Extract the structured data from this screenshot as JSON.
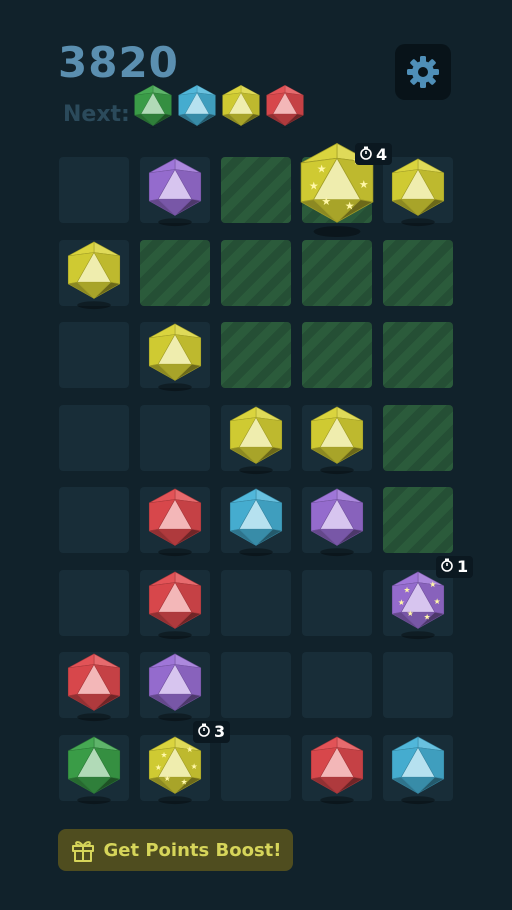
{
  "header": {
    "score": "3820",
    "next_label": "Next:",
    "settings_icon": "gear-icon"
  },
  "next_gems": [
    "green",
    "blue",
    "yellow",
    "red"
  ],
  "colors": {
    "purple": "#9a6fd6",
    "yellow": "#d8d234",
    "red": "#e04a4e",
    "blue": "#48b3d8",
    "green": "#3ca34a",
    "board_bg": "#11222b",
    "cell": "#182d38",
    "cell_green": "#2b5b3b",
    "score": "#5b8fb0",
    "boost_bg": "#4f4d1f",
    "boost_text": "#d6d55a"
  },
  "grid": {
    "rows": 8,
    "cols": 5,
    "cells": [
      [
        "empty",
        "purple",
        "empty",
        "yellow",
        "yellow"
      ],
      [
        "yellow",
        "empty",
        "empty",
        "empty",
        "empty"
      ],
      [
        "empty",
        "yellow",
        "empty",
        "empty",
        "empty"
      ],
      [
        "empty",
        "empty",
        "yellow",
        "yellow",
        "empty"
      ],
      [
        "empty",
        "red",
        "blue",
        "purple",
        "empty"
      ],
      [
        "empty",
        "red",
        "empty",
        "empty",
        "purple"
      ],
      [
        "red",
        "purple",
        "empty",
        "empty",
        "empty"
      ],
      [
        "green",
        "yellow",
        "empty",
        "red",
        "blue"
      ]
    ],
    "highlighted": [
      [
        0,
        2
      ],
      [
        0,
        3
      ],
      [
        1,
        1
      ],
      [
        1,
        2
      ],
      [
        1,
        3
      ],
      [
        1,
        4
      ],
      [
        2,
        2
      ],
      [
        2,
        3
      ],
      [
        2,
        4
      ],
      [
        3,
        4
      ],
      [
        4,
        4
      ]
    ],
    "special": [
      {
        "row": 0,
        "col": 3,
        "timer": "4",
        "big": true
      },
      {
        "row": 5,
        "col": 4,
        "timer": "1",
        "big": false
      },
      {
        "row": 7,
        "col": 1,
        "timer": "3",
        "big": false
      }
    ]
  },
  "boost": {
    "label": "Get Points Boost!",
    "icon": "gift-icon"
  }
}
